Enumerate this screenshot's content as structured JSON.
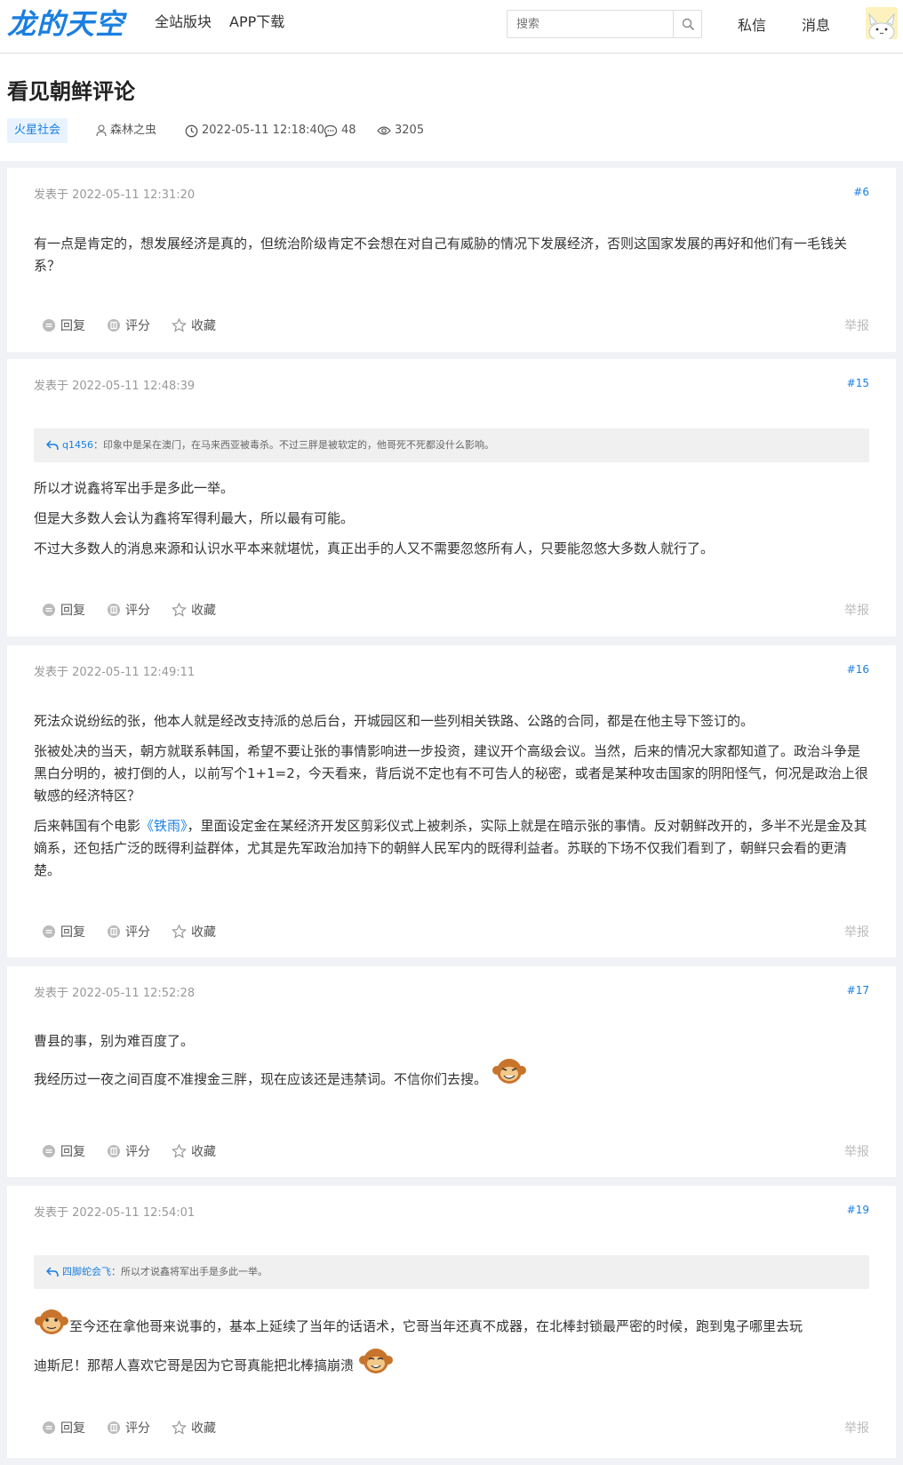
{
  "header": {
    "logo_text": "龙的天空",
    "nav": [
      "全站版块",
      "APP下载"
    ],
    "search_placeholder": "搜索",
    "links": [
      "私信",
      "消息"
    ]
  },
  "thread": {
    "title": "看见朝鲜评论",
    "tag": "火星社会",
    "author": "森林之虫",
    "datetime": "2022-05-11 12:18:40",
    "replies": "48",
    "views": "3205"
  },
  "action_labels": {
    "reply": "回复",
    "rate": "评分",
    "fav": "收藏",
    "report": "举报"
  },
  "posts": [
    {
      "time": "发表于 2022-05-11 12:31:20",
      "floor": "#6",
      "paragraphs": [
        "有一点是肯定的，想发展经济是真的，但统治阶级肯定不会想在对自己有威胁的情况下发展经济，否则这国家发展的再好和他们有一毛钱关系？"
      ]
    },
    {
      "time": "发表于 2022-05-11 12:48:39",
      "floor": "#15",
      "quote_user": "q1456",
      "quote_text": "：印象中是呆在澳门，在马来西亚被毒杀。不过三胖是被软定的，他哥死不死都没什么影响。",
      "paragraphs": [
        "所以才说鑫将军出手是多此一举。",
        "但是大多数人会认为鑫将军得利最大，所以最有可能。",
        "不过大多数人的消息来源和认识水平本来就堪忧，真正出手的人又不需要忽悠所有人，只要能忽悠大多数人就行了。"
      ]
    },
    {
      "time": "发表于 2022-05-11 12:49:11",
      "floor": "#16",
      "paragraphs": [
        "死法众说纷纭的张，他本人就是经改支持派的总后台，开城园区和一些列相关铁路、公路的合同，都是在他主导下签订的。",
        "张被处决的当天，朝方就联系韩国，希望不要让张的事情影响进一步投资，建议开个高级会议。当然，后来的情况大家都知道了。政治斗争是黑白分明的，被打倒的人，以前写个1+1=2，今天看来，背后说不定也有不可告人的秘密，或者是某种攻击国家的阴阳怪气，何况是政治上很敏感的经济特区？"
      ],
      "p3_before": "后来韩国有个电影",
      "p3_movie": "《铁雨》",
      "p3_after": "，里面设定金在某经济开发区剪彩仪式上被刺杀，实际上就是在暗示张的事情。反对朝鲜改开的，多半不光是金及其嫡系，还包括广泛的既得利益群体，尤其是先军政治加持下的朝鲜人民军内的既得利益者。苏联的下场不仅我们看到了，朝鲜只会看的更清楚。"
    },
    {
      "time": "发表于 2022-05-11 12:52:28",
      "floor": "#17",
      "paragraphs": [
        "曹县的事，别为难百度了。",
        "我经历过一夜之间百度不准搜金三胖，现在应该还是违禁词。不信你们去搜。"
      ]
    },
    {
      "time": "发表于 2022-05-11 12:54:01",
      "floor": "#19",
      "quote_user": "四脚蛇会飞",
      "quote_text": "：所以才说鑫将军出手是多此一举。",
      "paragraphs": [
        "至今还在拿他哥来说事的，基本上延续了当年的话语术，它哥当年还真不成器，在北棒封锁最严密的时候，跑到鬼子哪里去玩",
        "迪斯尼！那帮人喜欢它哥是因为它哥真能把北棒搞崩溃"
      ]
    }
  ],
  "colors": {
    "accent": "#1a7fe0",
    "background": "#f0f2f5",
    "quote_bg": "#f0f0f0"
  }
}
